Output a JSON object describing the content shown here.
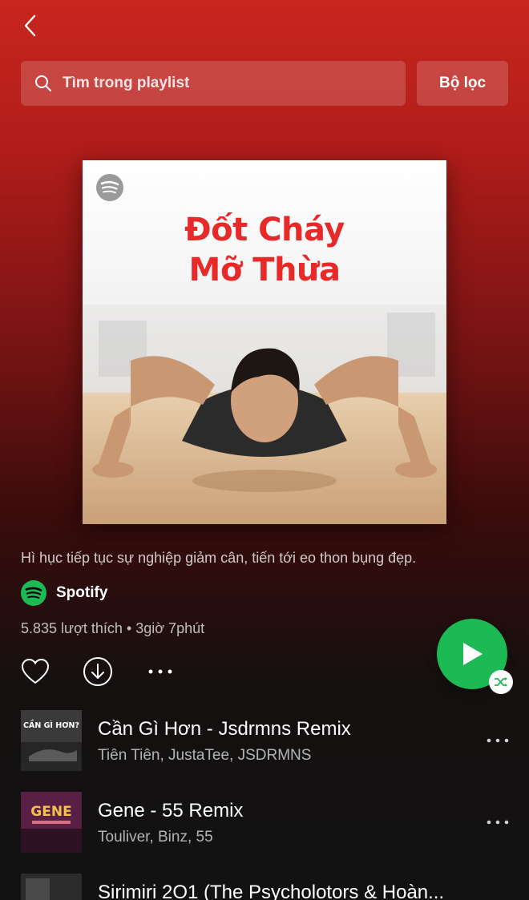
{
  "header": {
    "back_icon": "chevron-left-icon"
  },
  "search": {
    "placeholder": "Tìm trong playlist",
    "filter_label": "Bộ lọc"
  },
  "playlist": {
    "cover_title_line1": "Đốt Cháy",
    "cover_title_line2": "Mỡ Thừa",
    "description": "Hì hục tiếp tục sự nghiệp giảm cân, tiến tới eo thon bụng đẹp.",
    "owner": "Spotify",
    "meta": "5.835 lượt thích • 3giờ 7phút"
  },
  "colors": {
    "accent_green": "#1db954",
    "cover_title_red": "#e8292a",
    "header_red": "#c8261f"
  },
  "tracks": [
    {
      "title": "Cần Gì Hơn - Jsdrmns Remix",
      "artist": "Tiên Tiên, JustaTee, JSDRMNS",
      "art_text": "CẦN GÌ HƠN?"
    },
    {
      "title": "Gene - 55 Remix",
      "artist": "Touliver, Binz, 55",
      "art_text": "GENE"
    },
    {
      "title": "Sirimiri 2O1 (The Psycholotors & Hoàn...",
      "artist": "",
      "art_text": ""
    }
  ]
}
